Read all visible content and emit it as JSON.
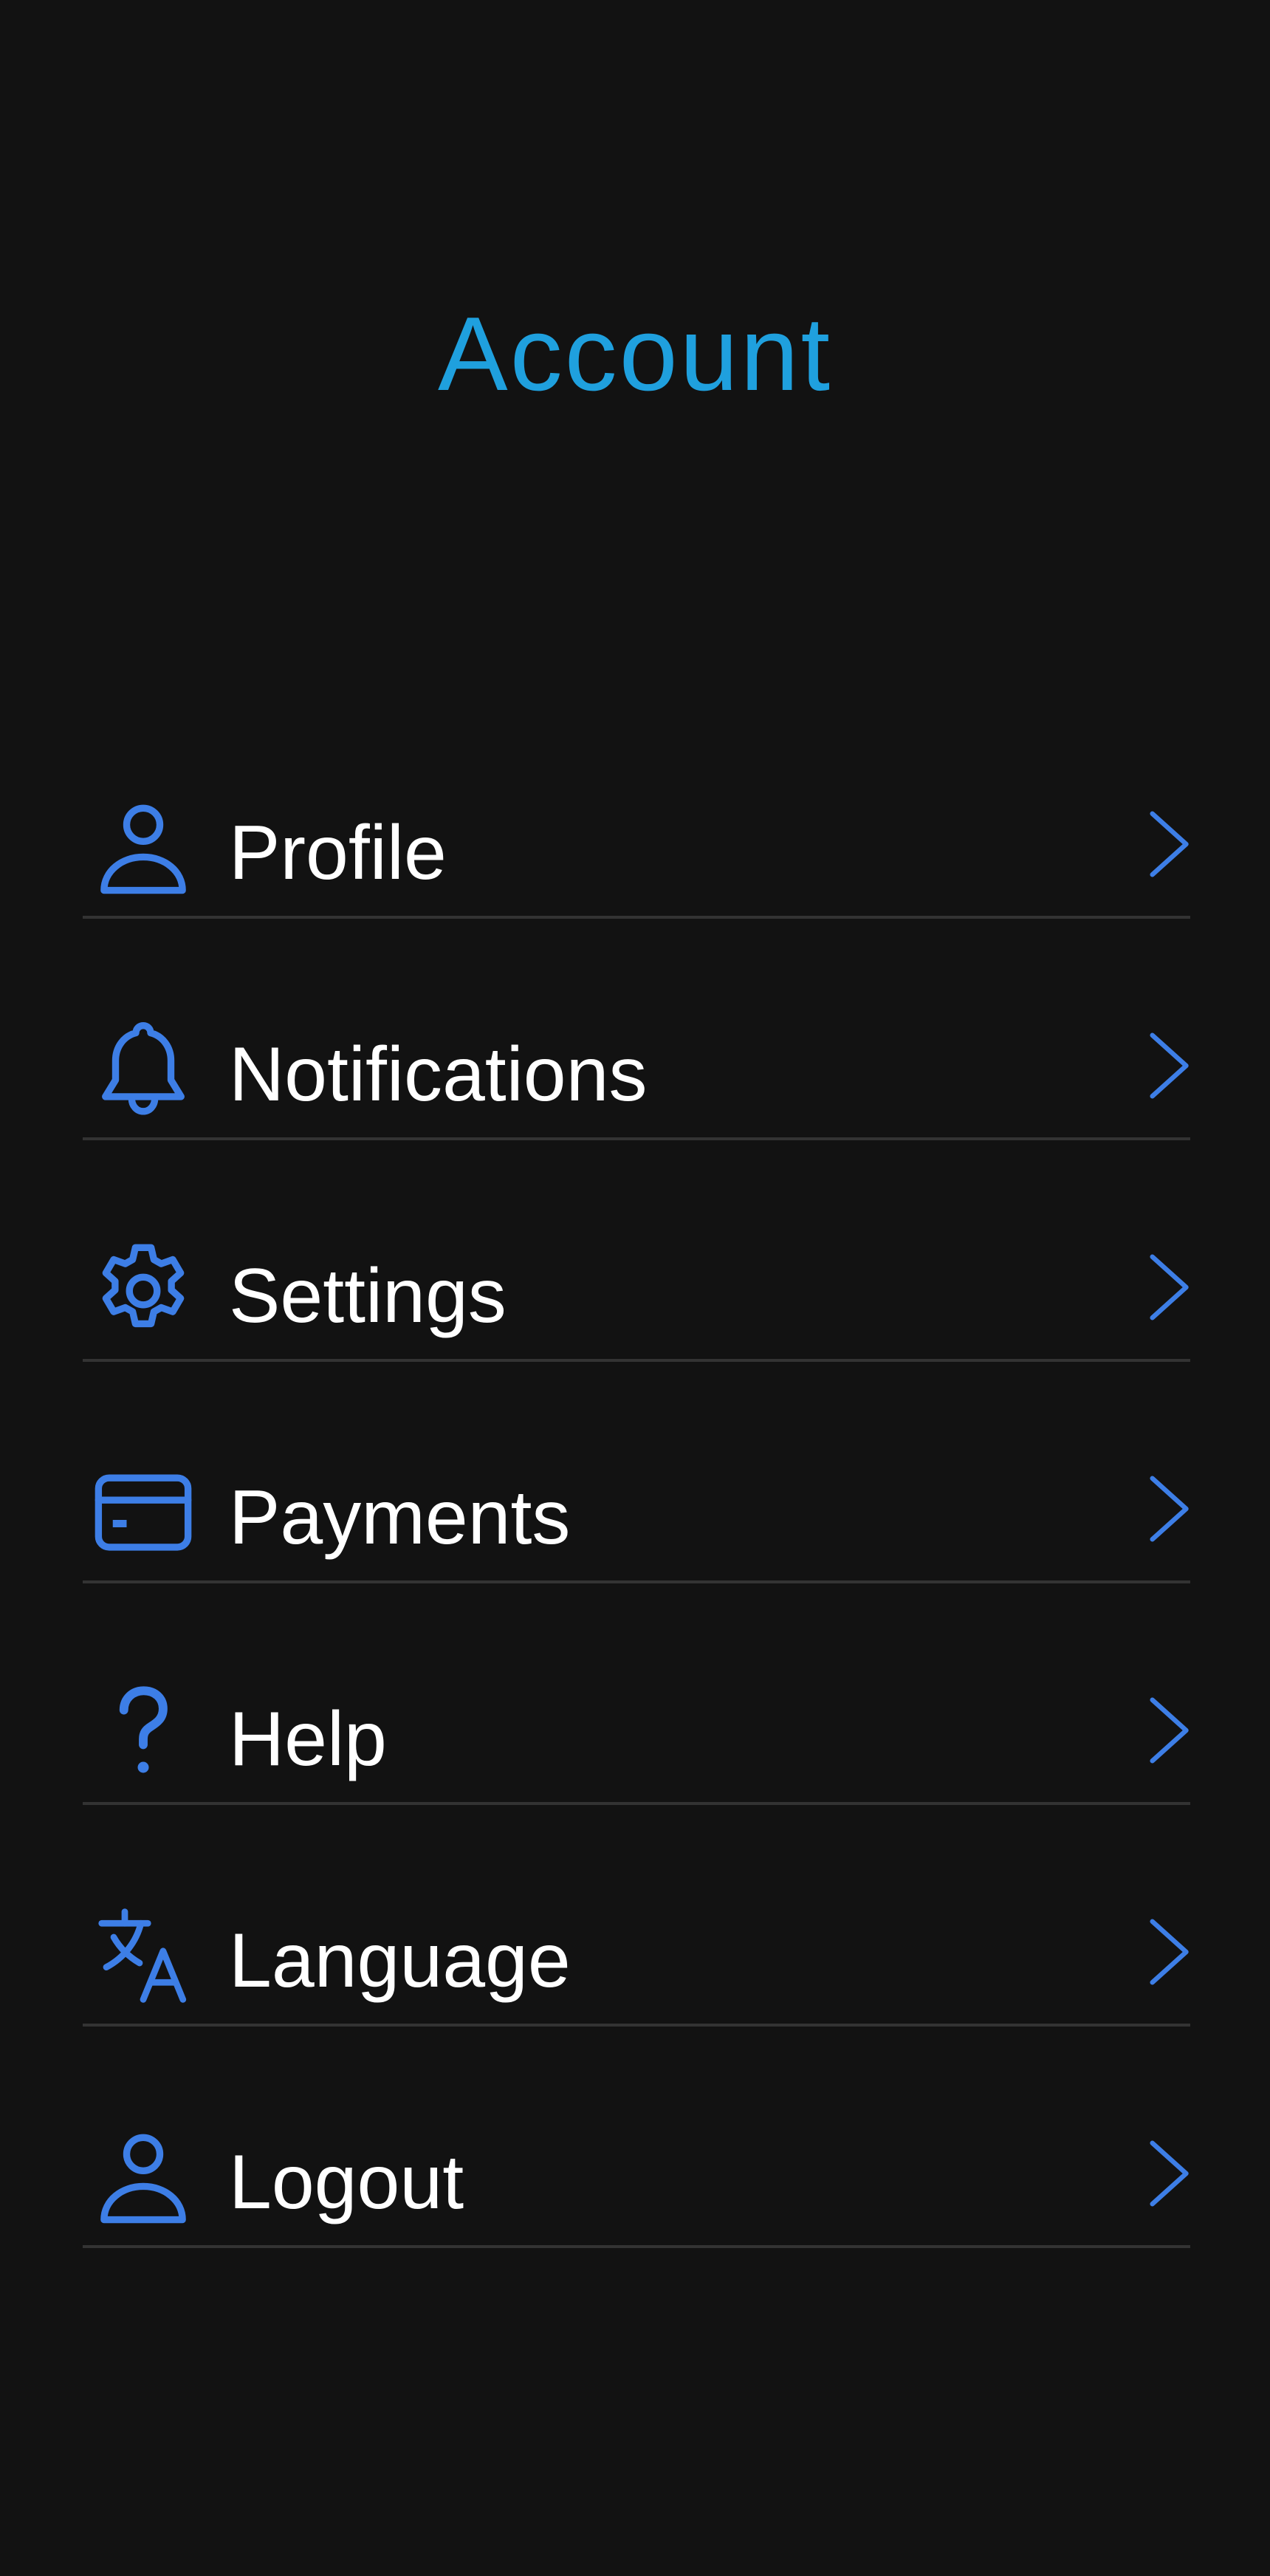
{
  "header": {
    "title": "Account",
    "title_color": "#1fa0de"
  },
  "theme": {
    "background": "#121212",
    "icon_color": "#3d7ee6",
    "text_color": "#ffffff",
    "divider_color": "#333333"
  },
  "menu": {
    "items": [
      {
        "label": "Profile",
        "icon": "person-icon"
      },
      {
        "label": "Notifications",
        "icon": "bell-icon"
      },
      {
        "label": "Settings",
        "icon": "gear-icon"
      },
      {
        "label": "Payments",
        "icon": "credit-card-icon"
      },
      {
        "label": "Help",
        "icon": "question-mark-icon"
      },
      {
        "label": "Language",
        "icon": "translate-icon"
      },
      {
        "label": "Logout",
        "icon": "person-icon"
      }
    ],
    "chevron_icon": "chevron-right-icon"
  }
}
